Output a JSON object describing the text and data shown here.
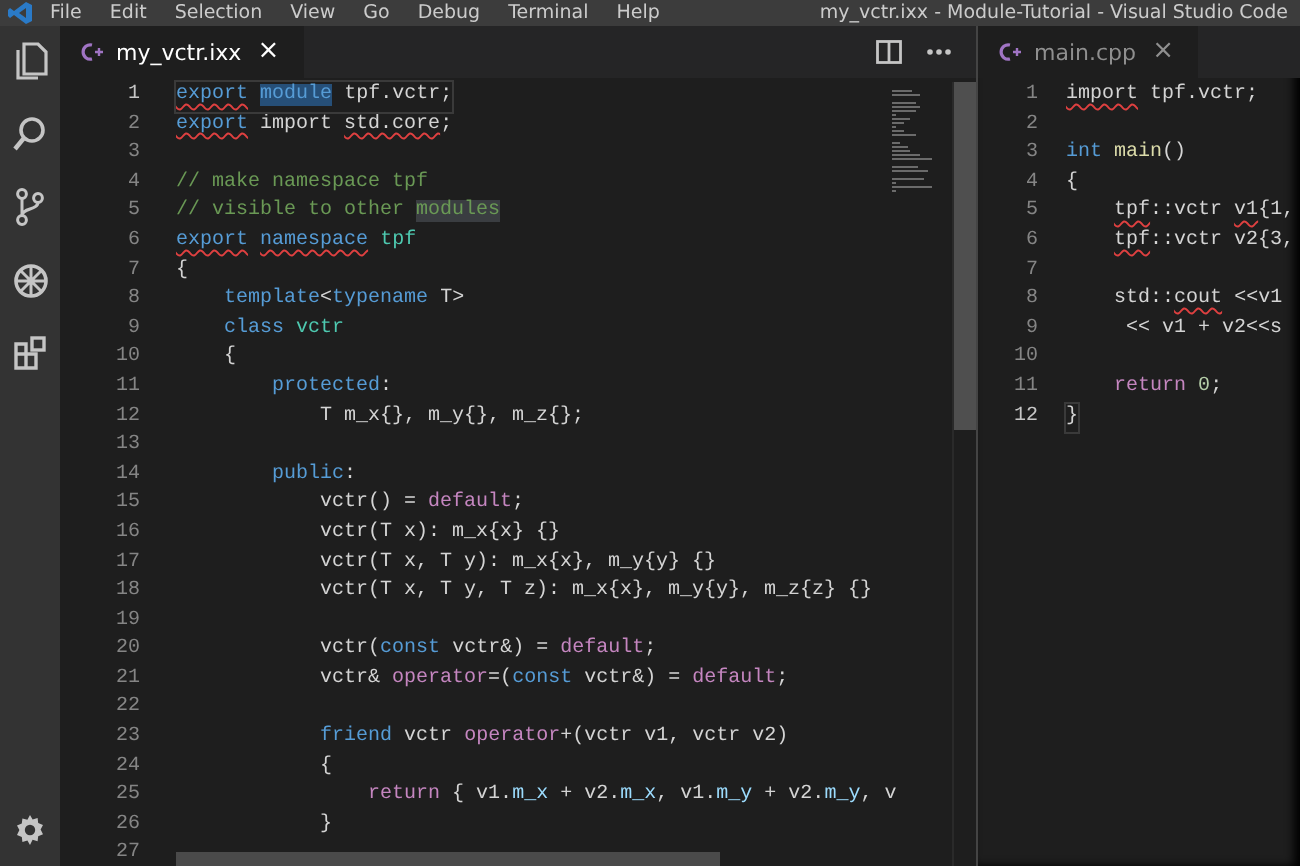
{
  "window": {
    "title": "my_vctr.ixx - Module-Tutorial - Visual Studio Code"
  },
  "menu": [
    "File",
    "Edit",
    "Selection",
    "View",
    "Go",
    "Debug",
    "Terminal",
    "Help"
  ],
  "editors": [
    {
      "focused": true,
      "tabs": [
        {
          "label": "my_vctr.ixx",
          "selected": true,
          "close": "×"
        }
      ],
      "lines": [
        {
          "number": "1",
          "current": true,
          "tokens": [
            {
              "kind": "kw-err",
              "text": "export"
            },
            {
              "kind": "sel",
              "text": " module"
            },
            {
              "kind": "plain",
              "text": " tpf.vctr;"
            }
          ]
        },
        {
          "number": "2",
          "current": false,
          "tokens": [
            {
              "kind": "kw-err",
              "text": "export"
            },
            {
              "kind": "plain",
              "text": " import "
            },
            {
              "kind": "plain-err",
              "text": "std.core"
            },
            {
              "kind": "plain",
              "text": ";"
            }
          ]
        },
        {
          "number": "3",
          "current": false
        },
        {
          "number": "4",
          "current": false,
          "tokens": [
            {
              "kind": "comment",
              "text": "// make namespace tpf"
            }
          ]
        },
        {
          "number": "5",
          "current": false,
          "tokens": [
            {
              "kind": "comment",
              "text": "// visible to other "
            },
            {
              "kind": "match",
              "text": "modules"
            }
          ]
        },
        {
          "number": "6",
          "current": false,
          "tokens": [
            {
              "kind": "kw-err",
              "text": "export"
            },
            {
              "kind": "kw-err",
              "text": " namespace"
            },
            {
              "kind": "type",
              "text": " tpf"
            }
          ]
        },
        {
          "number": "7",
          "current": false,
          "tokens": [
            {
              "kind": "plain",
              "text": "{"
            }
          ]
        },
        {
          "number": "8",
          "current": false,
          "tokens": [
            {
              "kind": "kw",
              "text": "    template"
            },
            {
              "kind": "plain",
              "text": "<"
            },
            {
              "kind": "kw",
              "text": "typename"
            },
            {
              "kind": "plain",
              "text": " T>"
            }
          ]
        },
        {
          "number": "9",
          "current": false,
          "tokens": [
            {
              "kind": "kw",
              "text": "    class"
            },
            {
              "kind": "type",
              "text": " vctr"
            }
          ]
        },
        {
          "number": "10",
          "current": false,
          "tokens": [
            {
              "kind": "plain",
              "text": "    {"
            }
          ]
        },
        {
          "number": "11",
          "current": false,
          "tokens": [
            {
              "kind": "kw",
              "text": "        protected"
            },
            {
              "kind": "plain",
              "text": ":"
            }
          ]
        },
        {
          "number": "12",
          "current": false,
          "tokens": [
            {
              "kind": "plain",
              "text": "            T m_x{}, m_y{}, m_z{};"
            }
          ]
        },
        {
          "number": "13",
          "current": false
        },
        {
          "number": "14",
          "current": false,
          "tokens": [
            {
              "kind": "kw",
              "text": "        public"
            },
            {
              "kind": "plain",
              "text": ":"
            }
          ]
        },
        {
          "number": "15",
          "current": false,
          "tokens": [
            {
              "kind": "plain",
              "text": "            vctr() = "
            },
            {
              "kind": "ctrl",
              "text": "default"
            },
            {
              "kind": "plain",
              "text": ";"
            }
          ]
        },
        {
          "number": "16",
          "current": false,
          "tokens": [
            {
              "kind": "plain",
              "text": "            vctr(T x): m_x{x} {}"
            }
          ]
        },
        {
          "number": "17",
          "current": false,
          "tokens": [
            {
              "kind": "plain",
              "text": "            vctr(T x, T y): m_x{x}, m_y{y} {}"
            }
          ]
        },
        {
          "number": "18",
          "current": false,
          "tokens": [
            {
              "kind": "plain",
              "text": "            vctr(T x, T y, T z): m_x{x}, m_y{y}, m_z{z} {}"
            }
          ]
        },
        {
          "number": "19",
          "current": false
        },
        {
          "number": "20",
          "current": false,
          "tokens": [
            {
              "kind": "plain",
              "text": "            vctr("
            },
            {
              "kind": "kw",
              "text": "const"
            },
            {
              "kind": "plain",
              "text": " vctr&) = "
            },
            {
              "kind": "ctrl",
              "text": "default"
            },
            {
              "kind": "plain",
              "text": ";"
            }
          ]
        },
        {
          "number": "21",
          "current": false,
          "tokens": [
            {
              "kind": "plain",
              "text": "            vctr& "
            },
            {
              "kind": "ctrl",
              "text": "operator"
            },
            {
              "kind": "plain",
              "text": "=("
            },
            {
              "kind": "kw",
              "text": "const"
            },
            {
              "kind": "plain",
              "text": " vctr&) = "
            },
            {
              "kind": "ctrl",
              "text": "default"
            },
            {
              "kind": "plain",
              "text": ";"
            }
          ]
        },
        {
          "number": "22",
          "current": false
        },
        {
          "number": "23",
          "current": false,
          "tokens": [
            {
              "kind": "kw",
              "text": "            friend"
            },
            {
              "kind": "plain",
              "text": " vctr "
            },
            {
              "kind": "ctrl",
              "text": "operator"
            },
            {
              "kind": "plain",
              "text": "+(vctr v1, vctr v2)"
            }
          ]
        },
        {
          "number": "24",
          "current": false,
          "tokens": [
            {
              "kind": "plain",
              "text": "            {"
            }
          ]
        },
        {
          "number": "25",
          "current": false,
          "tokens": [
            {
              "kind": "ctrl",
              "text": "                return"
            },
            {
              "kind": "plain",
              "text": " { v1."
            },
            {
              "kind": "var",
              "text": "m_x"
            },
            {
              "kind": "plain",
              "text": " + v2."
            },
            {
              "kind": "var",
              "text": "m_x"
            },
            {
              "kind": "plain",
              "text": ", v1."
            },
            {
              "kind": "var",
              "text": "m_y"
            },
            {
              "kind": "plain",
              "text": " + v2."
            },
            {
              "kind": "var",
              "text": "m_y"
            },
            {
              "kind": "plain",
              "text": ", v"
            }
          ]
        },
        {
          "number": "26",
          "current": false,
          "tokens": [
            {
              "kind": "plain",
              "text": "            }"
            }
          ]
        },
        {
          "number": "27",
          "current": false
        }
      ]
    },
    {
      "focused": false,
      "tabs": [
        {
          "label": "main.cpp",
          "selected": true,
          "close": "×"
        }
      ],
      "lines": [
        {
          "number": "1",
          "current": false,
          "tokens": [
            {
              "kind": "plain-err",
              "text": "import"
            },
            {
              "kind": "plain",
              "text": " tpf.vctr;"
            }
          ]
        },
        {
          "number": "2",
          "current": false
        },
        {
          "number": "3",
          "current": false,
          "tokens": [
            {
              "kind": "kw",
              "text": "int"
            },
            {
              "kind": "fn",
              "text": " main"
            },
            {
              "kind": "plain",
              "text": "()"
            }
          ]
        },
        {
          "number": "4",
          "current": false,
          "tokens": [
            {
              "kind": "plain",
              "text": "{"
            }
          ]
        },
        {
          "number": "5",
          "current": false,
          "tokens": [
            {
              "kind": "plain-err",
              "text": "    tpf"
            },
            {
              "kind": "plain",
              "text": "::vctr "
            },
            {
              "kind": "plain-err",
              "text": "v1"
            },
            {
              "kind": "plain",
              "text": "{1,"
            }
          ]
        },
        {
          "number": "6",
          "current": false,
          "tokens": [
            {
              "kind": "plain-err",
              "text": "    tpf"
            },
            {
              "kind": "plain",
              "text": "::vctr v2{3,"
            }
          ]
        },
        {
          "number": "7",
          "current": false
        },
        {
          "number": "8",
          "current": false,
          "tokens": [
            {
              "kind": "plain",
              "text": "    std::"
            },
            {
              "kind": "plain-err",
              "text": "cout"
            },
            {
              "kind": "plain",
              "text": " <<v1"
            }
          ]
        },
        {
          "number": "9",
          "current": false,
          "tokens": [
            {
              "kind": "plain",
              "text": "     << v1 + v2<<s"
            }
          ]
        },
        {
          "number": "10",
          "current": false
        },
        {
          "number": "11",
          "current": false,
          "tokens": [
            {
              "kind": "ctrl",
              "text": "    return"
            },
            {
              "kind": "num",
              "text": " 0"
            },
            {
              "kind": "plain",
              "text": ";"
            }
          ]
        },
        {
          "number": "12",
          "current": true,
          "tokens": [
            {
              "kind": "plain",
              "text": "}"
            }
          ]
        }
      ]
    }
  ]
}
